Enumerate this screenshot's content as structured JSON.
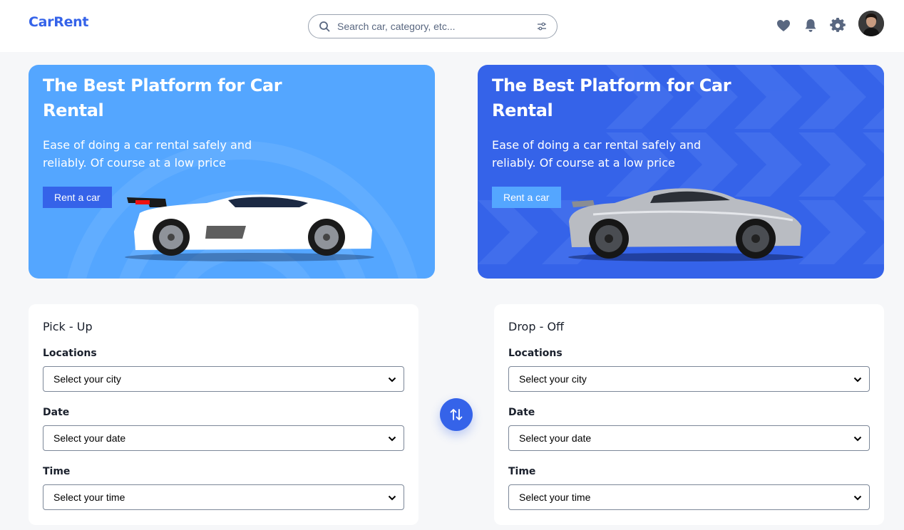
{
  "header": {
    "logo": "CarRent",
    "search_placeholder": "Search car, category, etc...",
    "icons": [
      "heart-icon",
      "bell-icon",
      "gear-icon",
      "avatar"
    ]
  },
  "banners": [
    {
      "title": "The Best Platform for Car Rental",
      "description": "Ease of doing a car rental safely and reliably. Of course at a low price",
      "button": "Rent a car",
      "background": "#54a6ff",
      "car": "white-race-car"
    },
    {
      "title": "The Best Platform for Car Rental",
      "description": "Ease of doing a car rental safely and reliably. Of course at a low price",
      "button": "Rent a car",
      "background": "#3563e9",
      "car": "silver-sports-car"
    }
  ],
  "pickup": {
    "title": "Pick - Up",
    "location_label": "Locations",
    "location_value": "Select your city",
    "date_label": "Date",
    "date_value": "Select your date",
    "time_label": "Time",
    "time_value": "Select your time"
  },
  "dropoff": {
    "title": "Drop - Off",
    "location_label": "Locations",
    "location_value": "Select your city",
    "date_label": "Date",
    "date_value": "Select your date",
    "time_label": "Time",
    "time_value": "Select your time"
  },
  "colors": {
    "accent": "#3563e9",
    "light_accent": "#54a6ff",
    "background": "#f6f7f9"
  }
}
